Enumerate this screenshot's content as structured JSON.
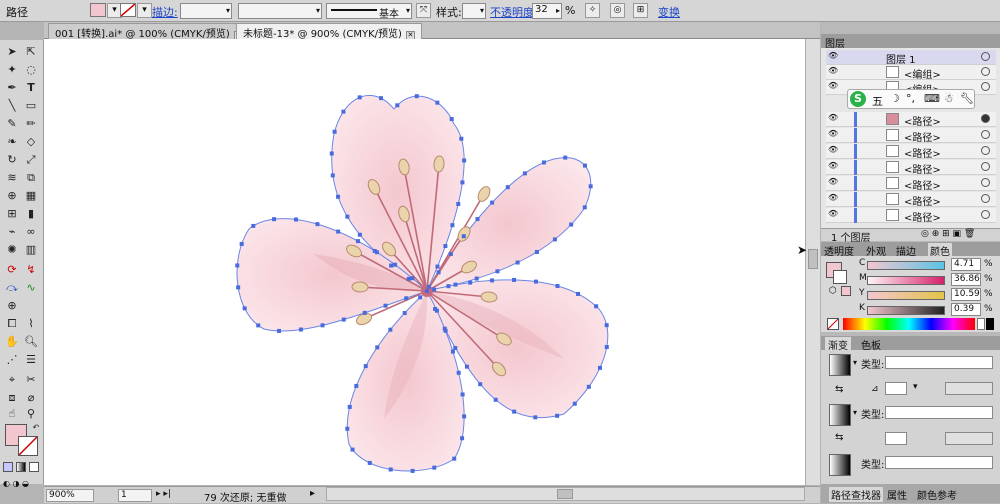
{
  "control_bar": {
    "selection_label": "路径",
    "fill_color": "#f2c6cf",
    "stroke_label": "描边:",
    "stroke_profile": "基本",
    "style_label": "样式:",
    "opacity_label": "不透明度:",
    "opacity_value": "32",
    "opacity_unit": "%",
    "transform_label": "变换"
  },
  "tabs": [
    {
      "label": "001 [转换].ai* @ 100% (CMYK/预览)",
      "active": false
    },
    {
      "label": "未标题-13* @ 900% (CMYK/预览)",
      "active": true
    }
  ],
  "status": {
    "zoom": "900%",
    "page": "1",
    "history": "79 次还原; 无重做"
  },
  "layers_panel": {
    "title": "图层",
    "layer_name": "图层 1",
    "rows": [
      "<编组>",
      "<编组>",
      "<路径>",
      "<路径>",
      "<路径>",
      "<路径>",
      "<路径>",
      "<路径>",
      "<路径>"
    ],
    "footer": "1 个图层"
  },
  "ime_bar": {
    "label": "五"
  },
  "color_panel": {
    "tabs": [
      "透明度",
      "外观",
      "描边",
      "颜色"
    ],
    "channels": [
      {
        "name": "C",
        "value": "4.71",
        "unit": "%"
      },
      {
        "name": "M",
        "value": "36.86",
        "unit": "%"
      },
      {
        "name": "Y",
        "value": "10.59",
        "unit": "%"
      },
      {
        "name": "K",
        "value": "0.39",
        "unit": "%"
      }
    ]
  },
  "gradient_panel": {
    "tabs": [
      "渐变",
      "色板"
    ],
    "type_label": "类型:"
  },
  "bottom_tabs": [
    "路径查找器",
    "属性",
    "颜色参考"
  ],
  "colors": {
    "accent_link": "#1d45c8",
    "petal": "#f6dce1",
    "petal_dark": "#eab3bd",
    "anchor": "#4a6bdd",
    "fill_swatch": "#f2c6cf"
  }
}
